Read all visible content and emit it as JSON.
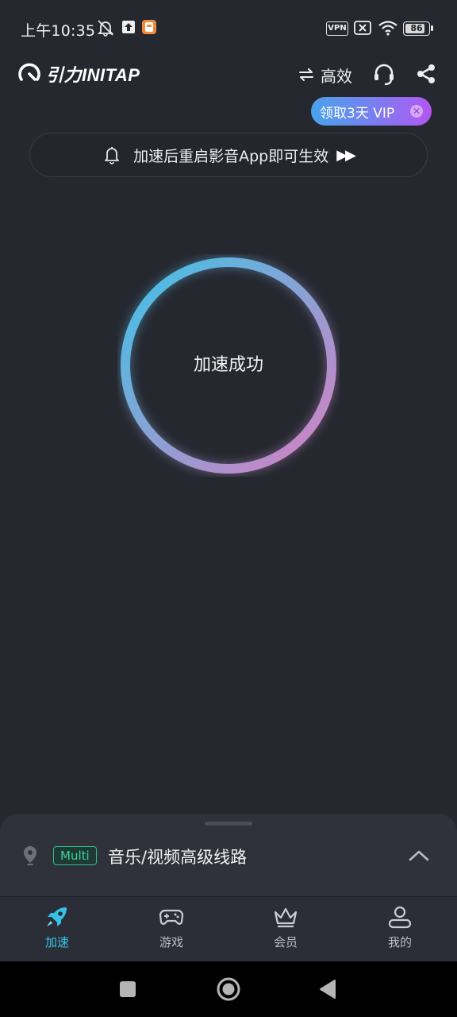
{
  "status_bar": {
    "time": "上午10:35",
    "vpn_label": "VPN",
    "battery_level": "86"
  },
  "header": {
    "logo_text": "引力INITAP",
    "mode_label": "高效"
  },
  "vip_banner": {
    "label": "领取3天 VIP"
  },
  "notice": {
    "text": "加速后重启影音App即可生效",
    "arrows": "▶▶"
  },
  "status_ring": {
    "label": "加速成功",
    "gradient_start": "#3ec3e6",
    "gradient_end": "#d77fc3"
  },
  "route": {
    "tag": "Multi",
    "name": "音乐/视频高级线路"
  },
  "bottom_nav": {
    "items": [
      {
        "label": "加速",
        "icon": "rocket-icon",
        "active": true
      },
      {
        "label": "游戏",
        "icon": "gamepad-icon",
        "active": false
      },
      {
        "label": "会员",
        "icon": "crown-icon",
        "active": false
      },
      {
        "label": "我的",
        "icon": "user-icon",
        "active": false
      }
    ]
  },
  "colors": {
    "background": "#262830",
    "accent": "#35c2e6",
    "multi_tag": "#3ad49b"
  }
}
